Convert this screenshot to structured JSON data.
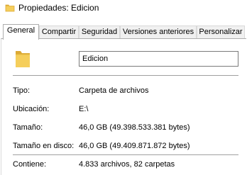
{
  "window": {
    "title": "Propiedades: Edicion",
    "title_icon": "folder-icon"
  },
  "tabs": [
    {
      "label": "General",
      "active": true
    },
    {
      "label": "Compartir",
      "active": false
    },
    {
      "label": "Seguridad",
      "active": false
    },
    {
      "label": "Versiones anteriores",
      "active": false
    },
    {
      "label": "Personalizar",
      "active": false
    }
  ],
  "general": {
    "folder_icon": "folder-icon",
    "name_value": "Edicion",
    "rows": [
      {
        "label": "Tipo:",
        "value": "Carpeta de archivos"
      },
      {
        "label": "Ubicación:",
        "value": "E:\\"
      },
      {
        "label": "Tamaño:",
        "value": "46,0 GB (49.398.533.381 bytes)"
      },
      {
        "label": "Tamaño en disco:",
        "value": "46,0 GB (49.409.871.872 bytes)"
      },
      {
        "label": "Contiene:",
        "value": "4.833 archivos, 82 carpetas"
      }
    ]
  },
  "colors": {
    "folder_body": "#F5CE5B",
    "folder_tab": "#DCA935",
    "accent_border": "#7A7A7A"
  }
}
